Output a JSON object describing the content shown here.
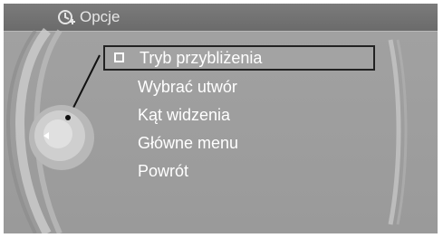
{
  "header": {
    "title": "Opcje",
    "icon": "settings-options-icon"
  },
  "menu": {
    "items": [
      {
        "label": "Tryb przybliżenia",
        "checkbox": true,
        "selected": true
      },
      {
        "label": "Wybrać utwór"
      },
      {
        "label": "Kąt widzenia"
      },
      {
        "label": "Główne menu"
      },
      {
        "label": "Powrót"
      }
    ]
  },
  "controller": {
    "icon": "left-arrow-icon"
  },
  "colors": {
    "background": "#9f9f9f",
    "header": "#737373",
    "text": "#ffffff",
    "highlight_border": "#222222"
  }
}
